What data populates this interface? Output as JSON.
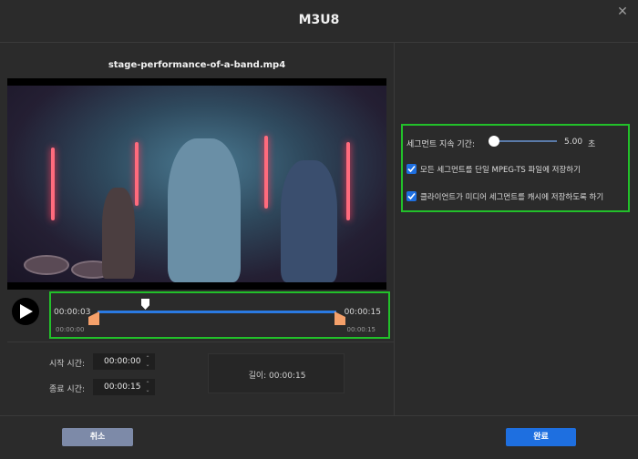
{
  "dialog": {
    "title": "M3U8",
    "close_symbol": "✕"
  },
  "video": {
    "filename": "stage-performance-of-a-band.mp4"
  },
  "timeline": {
    "start_time": "00:00:03",
    "end_time": "00:00:15",
    "trim_start": "00:00:00",
    "trim_end": "00:00:15",
    "playhead_fraction": 0.2,
    "track_color": "#2a7ae2",
    "handle_color": "#f5a06a"
  },
  "trim": {
    "start_label": "시작 시간:",
    "start_value": "00:00:00",
    "end_label": "종료 시간:",
    "end_value": "00:00:15",
    "length_text": "길이: 00:00:15"
  },
  "settings": {
    "segment_label": "세그먼트 지속 기간:",
    "segment_value": "5.00",
    "segment_unit": "초",
    "slider_fraction": 0.0,
    "options": [
      {
        "label": "모든 세그먼트를 단일 MPEG-TS 파일에 저장하기",
        "checked": true
      },
      {
        "label": "클라이언트가 미디어 세그먼트를 캐시에 저장하도록 하기",
        "checked": true
      }
    ],
    "highlight_color": "#22c02a"
  },
  "buttons": {
    "cancel": "취소",
    "done": "완료"
  },
  "colors": {
    "background": "#2b2b2b",
    "accent": "#1e6fe0",
    "cancel": "#7d8aa8"
  }
}
